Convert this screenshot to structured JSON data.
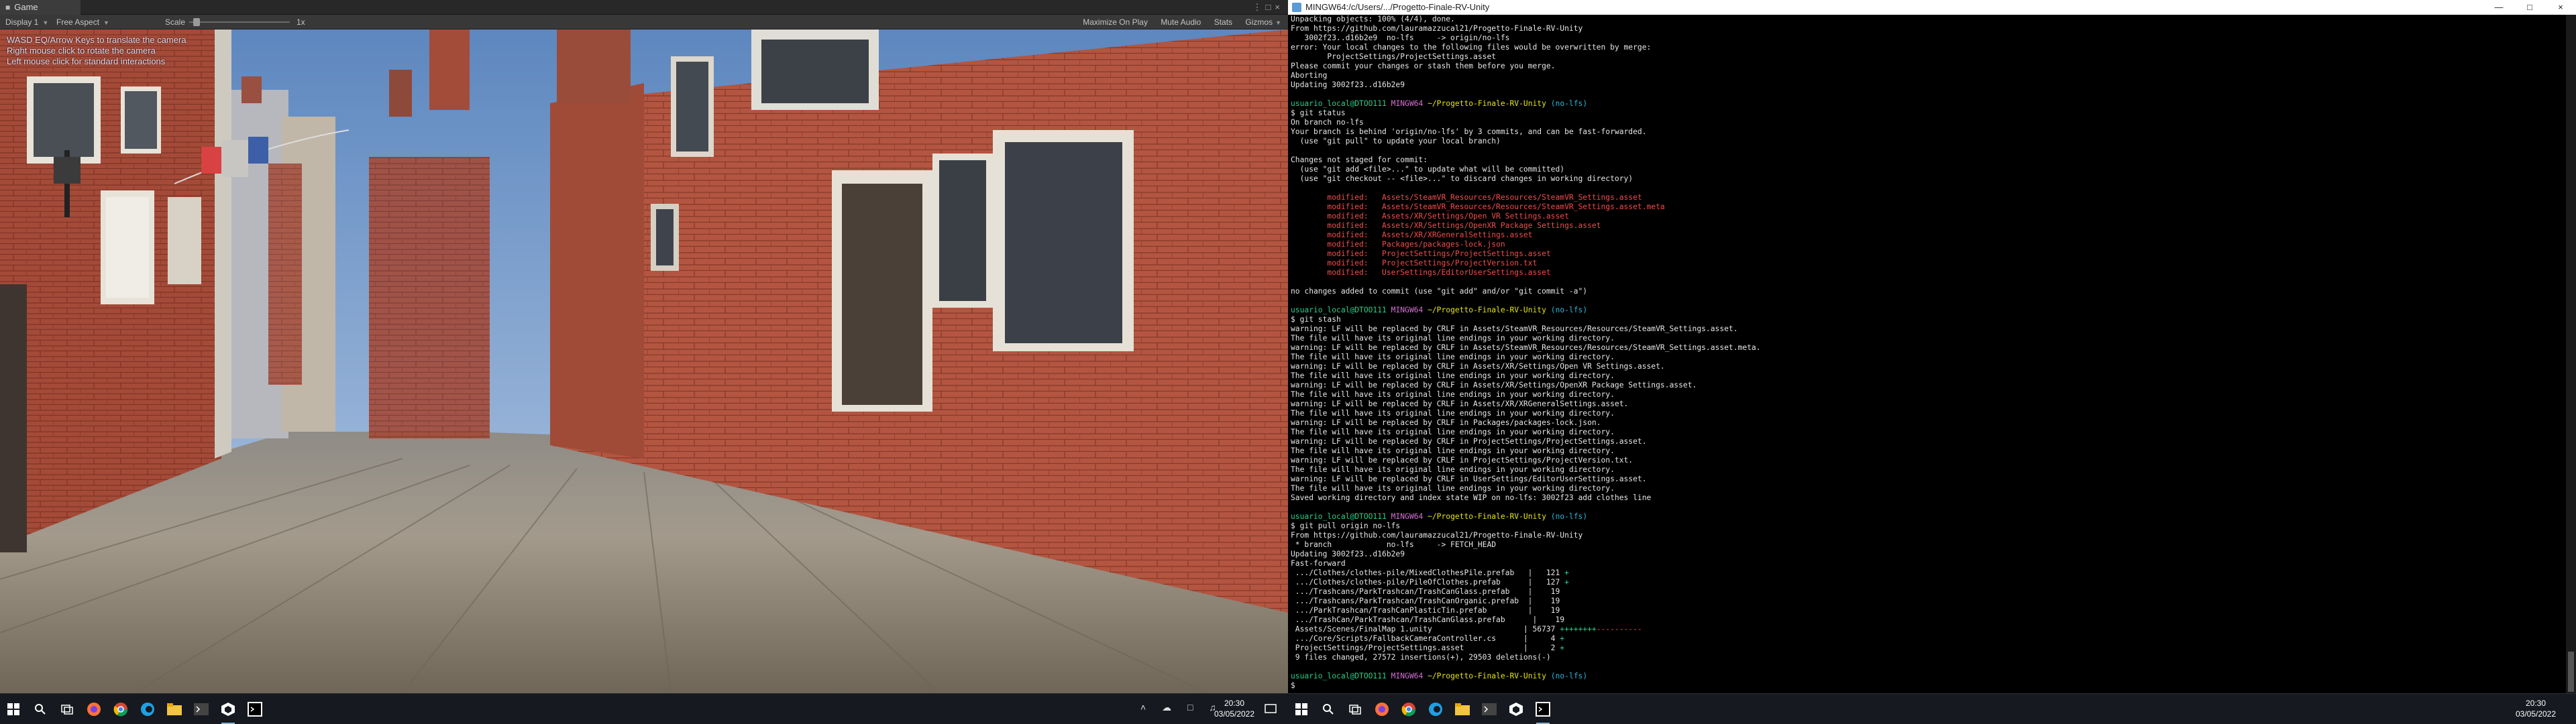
{
  "left_monitor": {
    "tab": {
      "label": "Game"
    },
    "toolbar": {
      "display": "Display 1",
      "aspect": "Free Aspect",
      "scale_label": "Scale",
      "scale_value": "1x",
      "maximize": "Maximize On Play",
      "mute": "Mute Audio",
      "stats": "Stats",
      "gizmos": "Gizmos"
    },
    "hud": [
      "WASD EQ/Arrow Keys to translate the camera",
      "Right mouse click to rotate the camera",
      "Left mouse click for standard interactions"
    ],
    "taskbar": {
      "icons": [
        "windows-logo-icon",
        "search-icon",
        "task-view-icon",
        "firefox-icon",
        "chrome-icon",
        "edge-icon",
        "file-explorer-icon",
        "terminal-icon",
        "unity-icon",
        "git-bash-icon"
      ],
      "time": "20:30",
      "date": "03/05/2022"
    }
  },
  "right_monitor": {
    "window_title": "MINGW64:/c/Users/.../Progetto-Finale-RV-Unity",
    "window_controls": [
      "minimize",
      "maximize",
      "close"
    ],
    "terminal_lines": [
      {
        "cls": "",
        "text": "Unpacking objects: 100% (4/4), done."
      },
      {
        "cls": "",
        "text": "From https://github.com/lauramazzucal21/Progetto-Finale-RV-Unity"
      },
      {
        "cls": "",
        "text": "   3002f23..d16b2e9  no-lfs     -> origin/no-lfs"
      },
      {
        "cls": "",
        "text": "error: Your local changes to the following files would be overwritten by merge:"
      },
      {
        "cls": "",
        "text": "        ProjectSettings/ProjectSettings.asset"
      },
      {
        "cls": "",
        "text": "Please commit your changes or stash them before you merge."
      },
      {
        "cls": "",
        "text": "Aborting"
      },
      {
        "cls": "",
        "text": "Updating 3002f23..d16b2e9"
      },
      {
        "cls": "",
        "text": ""
      },
      {
        "cls": "prompt",
        "user": "usuario_local@DTOO111",
        "host": "MINGW64",
        "path": "~/Progetto-Finale-RV-Unity",
        "branch": "(no-lfs)"
      },
      {
        "cls": "",
        "text": "$ git status"
      },
      {
        "cls": "",
        "text": "On branch no-lfs"
      },
      {
        "cls": "",
        "text": "Your branch is behind 'origin/no-lfs' by 3 commits, and can be fast-forwarded."
      },
      {
        "cls": "",
        "text": "  (use \"git pull\" to update your local branch)"
      },
      {
        "cls": "",
        "text": ""
      },
      {
        "cls": "",
        "text": "Changes not staged for commit:"
      },
      {
        "cls": "",
        "text": "  (use \"git add <file>...\" to update what will be committed)"
      },
      {
        "cls": "",
        "text": "  (use \"git checkout -- <file>...\" to discard changes in working directory)"
      },
      {
        "cls": "",
        "text": ""
      },
      {
        "cls": "c-red",
        "text": "        modified:   Assets/SteamVR_Resources/Resources/SteamVR_Settings.asset"
      },
      {
        "cls": "c-red",
        "text": "        modified:   Assets/SteamVR_Resources/Resources/SteamVR_Settings.asset.meta"
      },
      {
        "cls": "c-red",
        "text": "        modified:   Assets/XR/Settings/Open VR Settings.asset"
      },
      {
        "cls": "c-red",
        "text": "        modified:   Assets/XR/Settings/OpenXR Package Settings.asset"
      },
      {
        "cls": "c-red",
        "text": "        modified:   Assets/XR/XRGeneralSettings.asset"
      },
      {
        "cls": "c-red",
        "text": "        modified:   Packages/packages-lock.json"
      },
      {
        "cls": "c-red",
        "text": "        modified:   ProjectSettings/ProjectSettings.asset"
      },
      {
        "cls": "c-red",
        "text": "        modified:   ProjectSettings/ProjectVersion.txt"
      },
      {
        "cls": "c-red",
        "text": "        modified:   UserSettings/EditorUserSettings.asset"
      },
      {
        "cls": "",
        "text": ""
      },
      {
        "cls": "",
        "text": "no changes added to commit (use \"git add\" and/or \"git commit -a\")"
      },
      {
        "cls": "",
        "text": ""
      },
      {
        "cls": "prompt",
        "user": "usuario_local@DTOO111",
        "host": "MINGW64",
        "path": "~/Progetto-Finale-RV-Unity",
        "branch": "(no-lfs)"
      },
      {
        "cls": "",
        "text": "$ git stash"
      },
      {
        "cls": "",
        "text": "warning: LF will be replaced by CRLF in Assets/SteamVR_Resources/Resources/SteamVR_Settings.asset."
      },
      {
        "cls": "",
        "text": "The file will have its original line endings in your working directory."
      },
      {
        "cls": "",
        "text": "warning: LF will be replaced by CRLF in Assets/SteamVR_Resources/Resources/SteamVR_Settings.asset.meta."
      },
      {
        "cls": "",
        "text": "The file will have its original line endings in your working directory."
      },
      {
        "cls": "",
        "text": "warning: LF will be replaced by CRLF in Assets/XR/Settings/Open VR Settings.asset."
      },
      {
        "cls": "",
        "text": "The file will have its original line endings in your working directory."
      },
      {
        "cls": "",
        "text": "warning: LF will be replaced by CRLF in Assets/XR/Settings/OpenXR Package Settings.asset."
      },
      {
        "cls": "",
        "text": "The file will have its original line endings in your working directory."
      },
      {
        "cls": "",
        "text": "warning: LF will be replaced by CRLF in Assets/XR/XRGeneralSettings.asset."
      },
      {
        "cls": "",
        "text": "The file will have its original line endings in your working directory."
      },
      {
        "cls": "",
        "text": "warning: LF will be replaced by CRLF in Packages/packages-lock.json."
      },
      {
        "cls": "",
        "text": "The file will have its original line endings in your working directory."
      },
      {
        "cls": "",
        "text": "warning: LF will be replaced by CRLF in ProjectSettings/ProjectSettings.asset."
      },
      {
        "cls": "",
        "text": "The file will have its original line endings in your working directory."
      },
      {
        "cls": "",
        "text": "warning: LF will be replaced by CRLF in ProjectSettings/ProjectVersion.txt."
      },
      {
        "cls": "",
        "text": "The file will have its original line endings in your working directory."
      },
      {
        "cls": "",
        "text": "warning: LF will be replaced by CRLF in UserSettings/EditorUserSettings.asset."
      },
      {
        "cls": "",
        "text": "The file will have its original line endings in your working directory."
      },
      {
        "cls": "",
        "text": "Saved working directory and index state WIP on no-lfs: 3002f23 add clothes line"
      },
      {
        "cls": "",
        "text": ""
      },
      {
        "cls": "prompt",
        "user": "usuario_local@DTOO111",
        "host": "MINGW64",
        "path": "~/Progetto-Finale-RV-Unity",
        "branch": "(no-lfs)"
      },
      {
        "cls": "",
        "text": "$ git pull origin no-lfs"
      },
      {
        "cls": "",
        "text": "From https://github.com/lauramazzucal21/Progetto-Finale-RV-Unity"
      },
      {
        "cls": "",
        "text": " * branch            no-lfs     -> FETCH_HEAD"
      },
      {
        "cls": "",
        "text": "Updating 3002f23..d16b2e9"
      },
      {
        "cls": "",
        "text": "Fast-forward"
      },
      {
        "cls": "diff",
        "text": " .../Clothes/clothes-pile/MixedClothesPile.prefab   |   121 ",
        "plus": "+",
        "minus": ""
      },
      {
        "cls": "diff",
        "text": " .../Clothes/clothes-pile/PileOfClothes.prefab      |   127 ",
        "plus": "+",
        "minus": ""
      },
      {
        "cls": "diff",
        "text": " .../Trashcans/ParkTrashcan/TrashCanGlass.prefab    |    19 ",
        "plus": "",
        "minus": ""
      },
      {
        "cls": "diff",
        "text": " .../Trashcans/ParkTrashcan/TrashCanOrganic.prefab  |    19 ",
        "plus": "",
        "minus": ""
      },
      {
        "cls": "diff",
        "text": " .../ParkTrashcan/TrashCanPlasticTin.prefab         |    19 ",
        "plus": "",
        "minus": ""
      },
      {
        "cls": "diff",
        "text": " .../TrashCan/ParkTrashcan/TrashCanGlass.prefab      |    19 ",
        "plus": "",
        "minus": ""
      },
      {
        "cls": "diff",
        "text": " Assets/Scenes/FinalMap 1.unity                    | 56737 ",
        "plus": "++++++++",
        "minus": "----------"
      },
      {
        "cls": "diff",
        "text": " .../Core/Scripts/FallbackCameraController.cs      |     4 ",
        "plus": "+",
        "minus": ""
      },
      {
        "cls": "diff",
        "text": " ProjectSettings/ProjectSettings.asset             |     2 ",
        "plus": "+",
        "minus": ""
      },
      {
        "cls": "",
        "text": " 9 files changed, 27572 insertions(+), 29503 deletions(-)"
      },
      {
        "cls": "",
        "text": ""
      },
      {
        "cls": "prompt",
        "user": "usuario_local@DTOO111",
        "host": "MINGW64",
        "path": "~/Progetto-Finale-RV-Unity",
        "branch": "(no-lfs)"
      },
      {
        "cls": "",
        "text": "$ "
      }
    ],
    "taskbar": {
      "icons": [
        "windows-logo-icon",
        "search-icon",
        "task-view-icon",
        "firefox-icon",
        "chrome-icon",
        "edge-icon",
        "file-explorer-icon",
        "terminal-icon",
        "unity-icon",
        "git-bash-icon"
      ],
      "time": "20:30",
      "date": "03/05/2022"
    }
  },
  "colors": {
    "unity_bg": "#282828",
    "terminal_bg": "#000000",
    "prompt_user": "#23d18b",
    "prompt_host": "#d670d6",
    "prompt_path": "#e5e510",
    "prompt_branch": "#29b8db",
    "modified_red": "#f14c4c"
  }
}
